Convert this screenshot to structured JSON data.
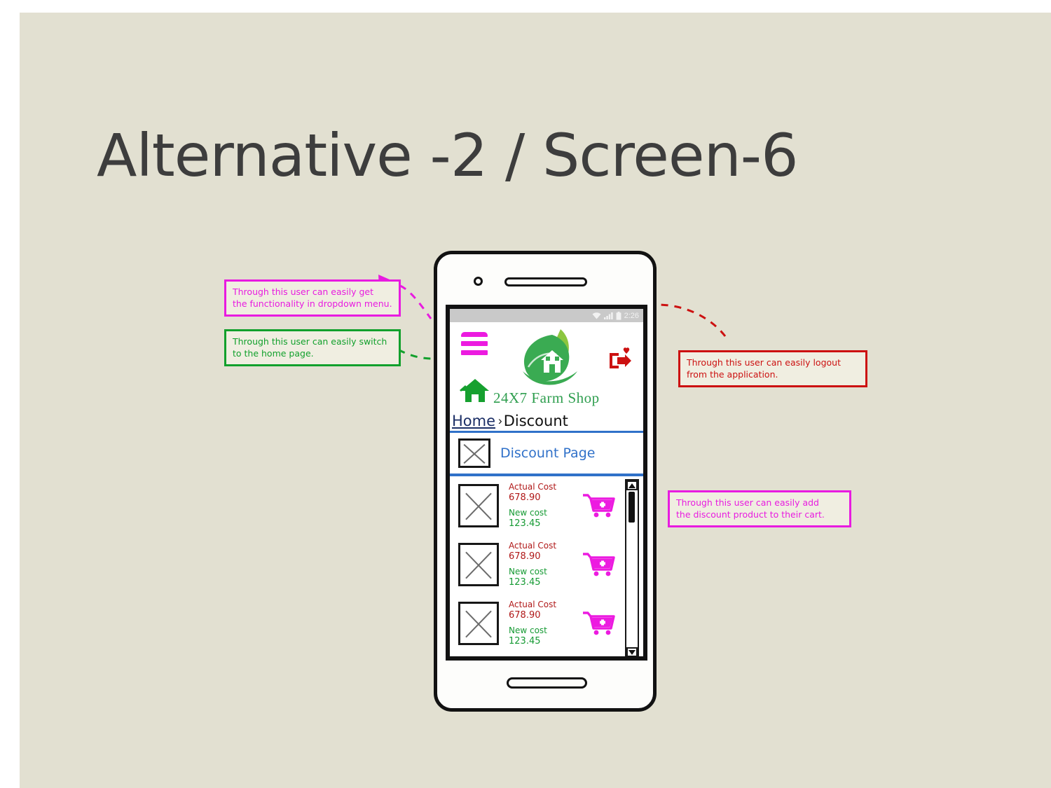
{
  "slide": {
    "title": "Alternative -2 / Screen-6",
    "background_color": "#e2e0d1"
  },
  "phone": {
    "status_bar": {
      "time": "2:26",
      "icons": [
        "wifi-icon",
        "signal-icon",
        "battery-icon"
      ]
    }
  },
  "app": {
    "header": {
      "menu_icon": "hamburger-menu-icon",
      "home_icon": "home-icon",
      "logo_icon": "leaf-house-logo-icon",
      "brand": "24X7 Farm Shop",
      "logout_icon": "logout-icon",
      "brand_color": "#2f9e4f",
      "menu_color": "#ec1be0",
      "logout_color": "#cc1111"
    },
    "breadcrumb": {
      "home": "Home",
      "separator": "›",
      "current": "Discount"
    },
    "page": {
      "thumbnail": "image-placeholder",
      "title": "Discount Page",
      "title_color": "#3071c9"
    },
    "products": [
      {
        "thumbnail": "image-placeholder",
        "actual_label": "Actual Cost",
        "actual_value": "678.90",
        "new_label": "New cost",
        "new_value": "123.45",
        "cart_button": "add-to-cart-icon"
      },
      {
        "thumbnail": "image-placeholder",
        "actual_label": "Actual Cost",
        "actual_value": "678.90",
        "new_label": "New cost",
        "new_value": "123.45",
        "cart_button": "add-to-cart-icon"
      },
      {
        "thumbnail": "image-placeholder",
        "actual_label": "Actual Cost",
        "actual_value": "678.90",
        "new_label": "New cost",
        "new_value": "123.45",
        "cart_button": "add-to-cart-icon"
      }
    ],
    "scrollbar": {
      "up_arrow": "scroll-up-arrow-icon",
      "down_arrow": "scroll-down-arrow-icon"
    },
    "colors": {
      "actual_cost": "#b01818",
      "new_cost": "#159a33",
      "cart": "#ec1be0",
      "divider": "#3071c9"
    }
  },
  "annotations": {
    "menu": {
      "text": "Through this user can easily get\nthe functionality in dropdown menu.",
      "color": "#e81be0"
    },
    "home": {
      "text": "Through this user can easily switch\nto the home page.",
      "color": "#12a02c"
    },
    "logout": {
      "text": "Through this user can easily logout\nfrom the application.",
      "color": "#cc1111"
    },
    "cart": {
      "text": "Through this user can easily add\nthe discount product to their cart.",
      "color": "#e81be0"
    }
  }
}
